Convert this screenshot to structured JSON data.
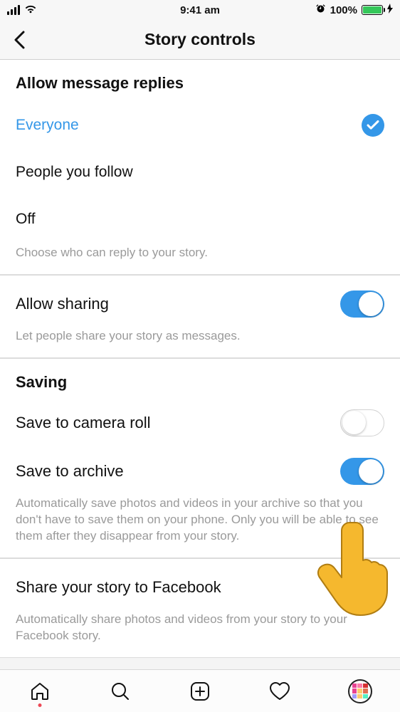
{
  "status": {
    "time": "9:41 am",
    "battery_pct": "100%"
  },
  "header": {
    "title": "Story controls"
  },
  "replies": {
    "heading": "Allow message replies",
    "options": {
      "everyone": "Everyone",
      "followed": "People you follow",
      "off": "Off"
    },
    "hint": "Choose who can reply to your story."
  },
  "sharing": {
    "label": "Allow sharing",
    "hint": "Let people share your story as messages."
  },
  "saving": {
    "heading": "Saving",
    "camera_roll": "Save to camera roll",
    "archive": "Save to archive",
    "hint": "Automatically save photos and videos in your archive so that you don't have to save them on your phone. Only you will be able to see them after they disappear from your story."
  },
  "facebook": {
    "label": "Share your story to Facebook",
    "hint": "Automatically share photos and videos from your story to your Facebook story."
  },
  "toggles": {
    "allow_sharing": true,
    "save_camera_roll": false,
    "save_archive": true,
    "share_facebook": false
  }
}
